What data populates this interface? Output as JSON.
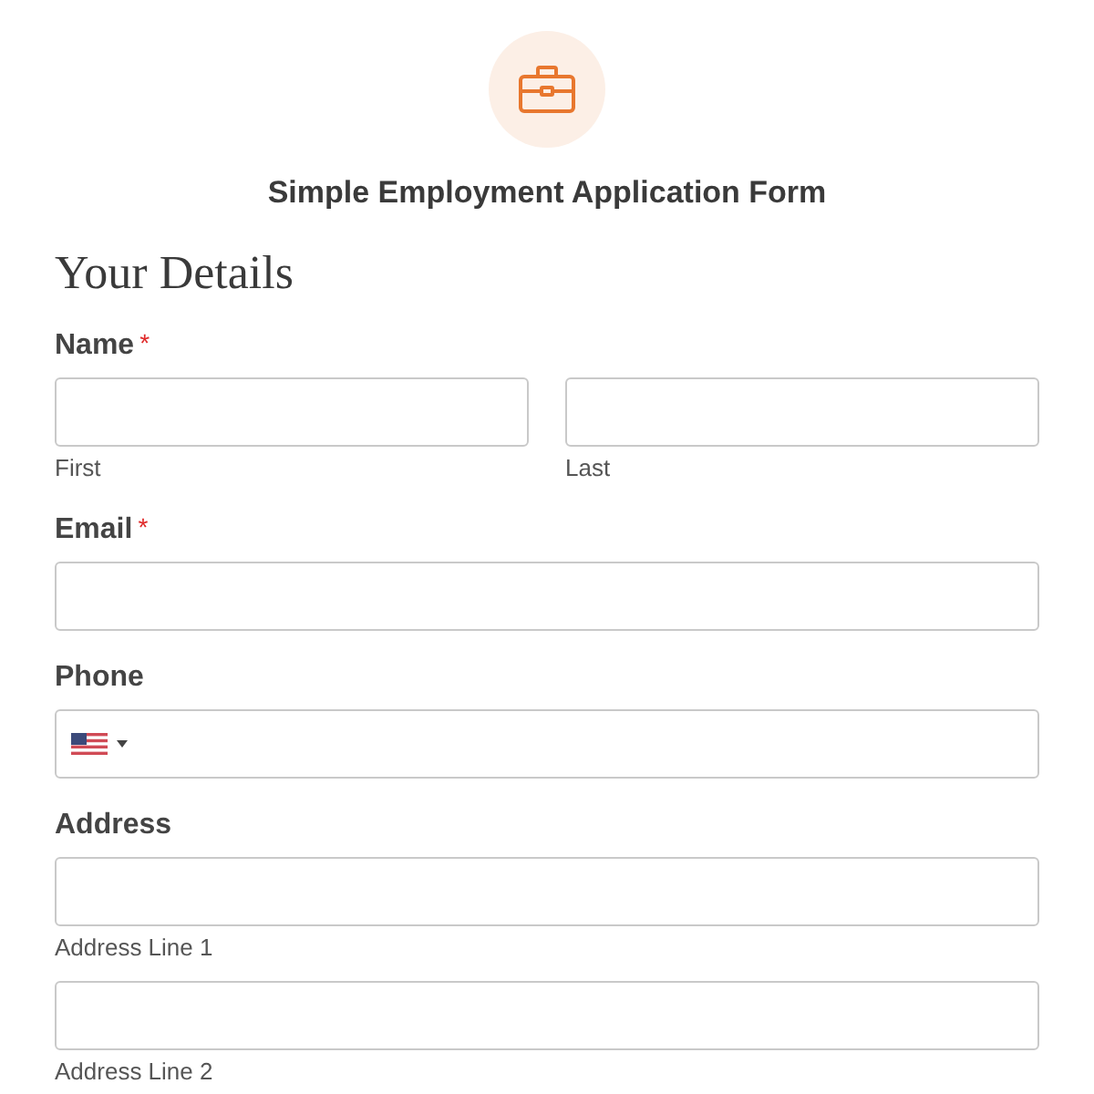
{
  "header": {
    "title": "Simple Employment Application Form"
  },
  "section": {
    "heading": "Your Details"
  },
  "required_mark": "*",
  "fields": [
    {
      "kind": "split",
      "label": "Name",
      "required": true,
      "sublabels": [
        "First",
        "Last"
      ]
    },
    {
      "kind": "single",
      "label": "Email",
      "required": true
    },
    {
      "kind": "phone",
      "label": "Phone",
      "required": false
    },
    {
      "kind": "stacked",
      "label": "Address",
      "required": false,
      "sublabels": [
        "Address Line 1",
        "Address Line 2"
      ]
    }
  ]
}
